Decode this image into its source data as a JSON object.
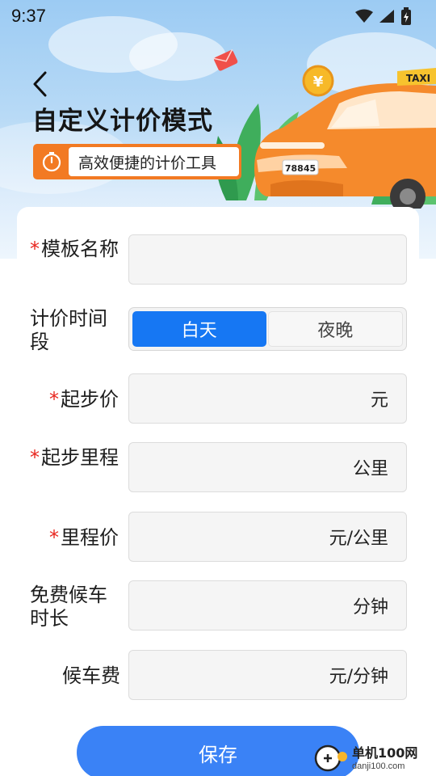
{
  "status_bar": {
    "time": "9:37"
  },
  "header": {
    "title": "自定义计价模式",
    "subtitle": "高效便捷的计价工具"
  },
  "illustration": {
    "taxi_sign": "TAXI",
    "plate": "78845",
    "coin_symbol": "¥",
    "car_color": "#f58a2c"
  },
  "form": {
    "template_name": {
      "label": "模板名称",
      "required": true,
      "value": ""
    },
    "time_period": {
      "label": "计价时间段",
      "options": [
        "白天",
        "夜晚"
      ],
      "selected": "白天"
    },
    "base_price": {
      "label": "起步价",
      "required": true,
      "unit": "元"
    },
    "base_distance": {
      "label": "起步里程",
      "required": true,
      "unit": "公里"
    },
    "mileage_price": {
      "label": "里程价",
      "required": true,
      "unit": "元/公里"
    },
    "free_wait": {
      "label": "免费候车时长",
      "required": false,
      "unit": "分钟"
    },
    "wait_fee": {
      "label": "候车费",
      "required": false,
      "unit": "元/分钟"
    },
    "save_label": "保存"
  },
  "watermark": {
    "main": "单机100网",
    "sub": "danji100.com"
  },
  "colors": {
    "accent": "#1677f3",
    "button": "#3a82f6",
    "badge": "#f27a23",
    "required": "#e8261f"
  }
}
